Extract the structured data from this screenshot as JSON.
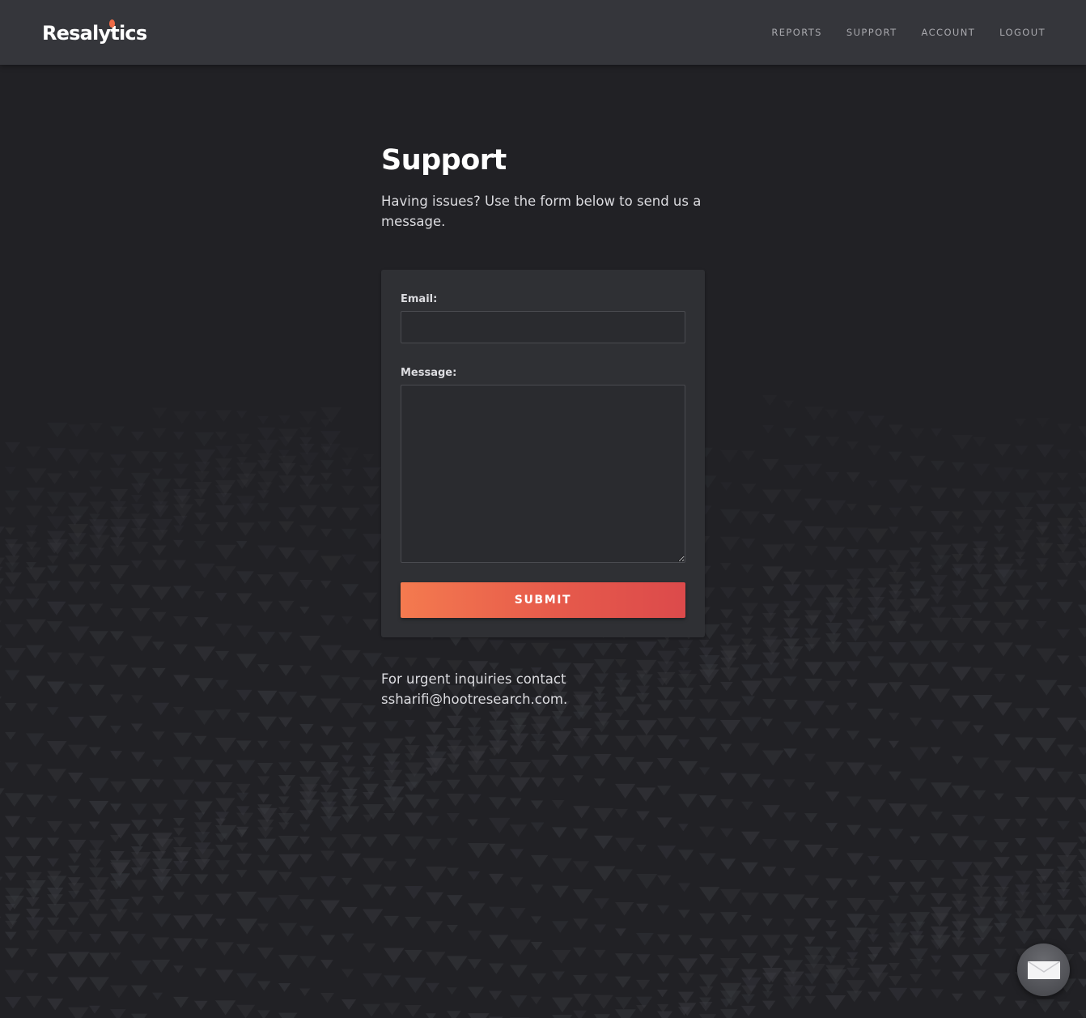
{
  "header": {
    "logo_text": "Resalytics",
    "nav": {
      "reports": "REPORTS",
      "support": "SUPPORT",
      "account": "ACCOUNT",
      "logout": "LOGOUT"
    }
  },
  "main": {
    "title": "Support",
    "intro": "Having issues? Use the form below to send us a message."
  },
  "form": {
    "email_label": "Email:",
    "email_value": "",
    "message_label": "Message:",
    "message_value": "",
    "submit_label": "SUBMIT"
  },
  "footer_note": {
    "prefix": "For urgent inquiries contact ",
    "email": "ssharifi@hootresearch.com",
    "suffix": "."
  },
  "chat_widget": {
    "icon": "mail-icon"
  },
  "colors": {
    "background": "#212125",
    "header": "#35363b",
    "card": "#2f3034",
    "accent_start": "#f47a4f",
    "accent_end": "#dc4a4b",
    "logo_flame": "#ef6b47"
  }
}
